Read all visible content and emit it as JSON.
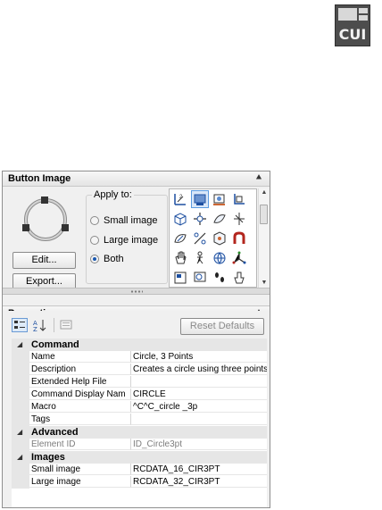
{
  "cui_icon": {
    "label": "CUI",
    "icon": "cui-editor-icon"
  },
  "button_image": {
    "title": "Button Image",
    "edit_label": "Edit...",
    "export_label": "Export...",
    "apply_to_label": "Apply to:",
    "options": [
      "Small image",
      "Large image",
      "Both"
    ],
    "selected_option": "Both",
    "icons": [
      "align-icon",
      "render-icon",
      "camera-icon",
      "ucs-icon",
      "3d-box-icon",
      "move-icon",
      "link-icon",
      "orbit-icon",
      "rotate-icon",
      "slash-icon",
      "view-icon",
      "magnet-icon",
      "pan-icon",
      "walk-icon",
      "globe-icon",
      "axis-icon",
      "layout-icon",
      "zoom-icon",
      "footsteps-icon",
      "hand-icon",
      "circle-icon",
      "sheet-icon",
      "window-icon",
      "pencil-icon"
    ]
  },
  "properties": {
    "title": "Properties",
    "reset_label": "Reset Defaults",
    "categories": [
      {
        "name": "Command",
        "rows": [
          {
            "name": "Name",
            "value": "Circle, 3 Points"
          },
          {
            "name": "Description",
            "value": "Creates a circle using three points"
          },
          {
            "name": "Extended Help File",
            "value": ""
          },
          {
            "name": "Command Display Nam",
            "value": "CIRCLE"
          },
          {
            "name": "Macro",
            "value": "^C^C_circle _3p"
          },
          {
            "name": "Tags",
            "value": ""
          }
        ]
      },
      {
        "name": "Advanced",
        "rows": [
          {
            "name": "Element ID",
            "value": "ID_Circle3pt"
          }
        ]
      },
      {
        "name": "Images",
        "rows": [
          {
            "name": "Small image",
            "value": "RCDATA_16_CIR3PT"
          },
          {
            "name": "Large image",
            "value": "RCDATA_32_CIR3PT"
          }
        ]
      }
    ]
  }
}
